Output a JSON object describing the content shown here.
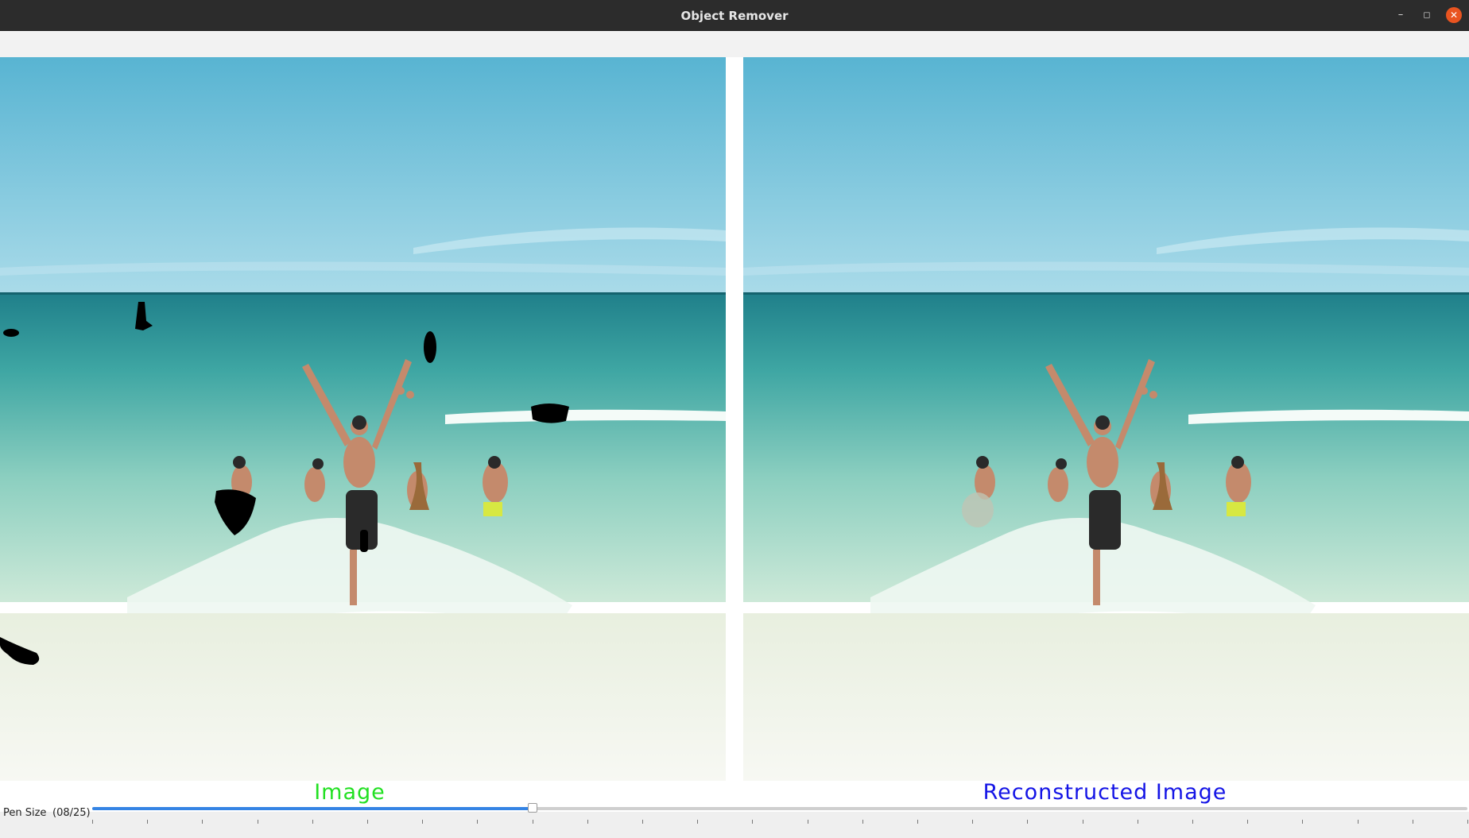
{
  "window": {
    "title": "Object Remover"
  },
  "panels": {
    "left_caption": "Image",
    "right_caption": "Reconstructed Image"
  },
  "colors": {
    "left_caption": "#22e022",
    "right_caption": "#1414e6",
    "mask": "#000000",
    "slider_accent": "#3584e4"
  },
  "pen_size": {
    "label": "Pen Size",
    "value_text": "(08/25)",
    "value": 8,
    "max": 25
  },
  "icons": {
    "minimize": "minimize-icon",
    "maximize": "maximize-icon",
    "close": "close-icon"
  }
}
